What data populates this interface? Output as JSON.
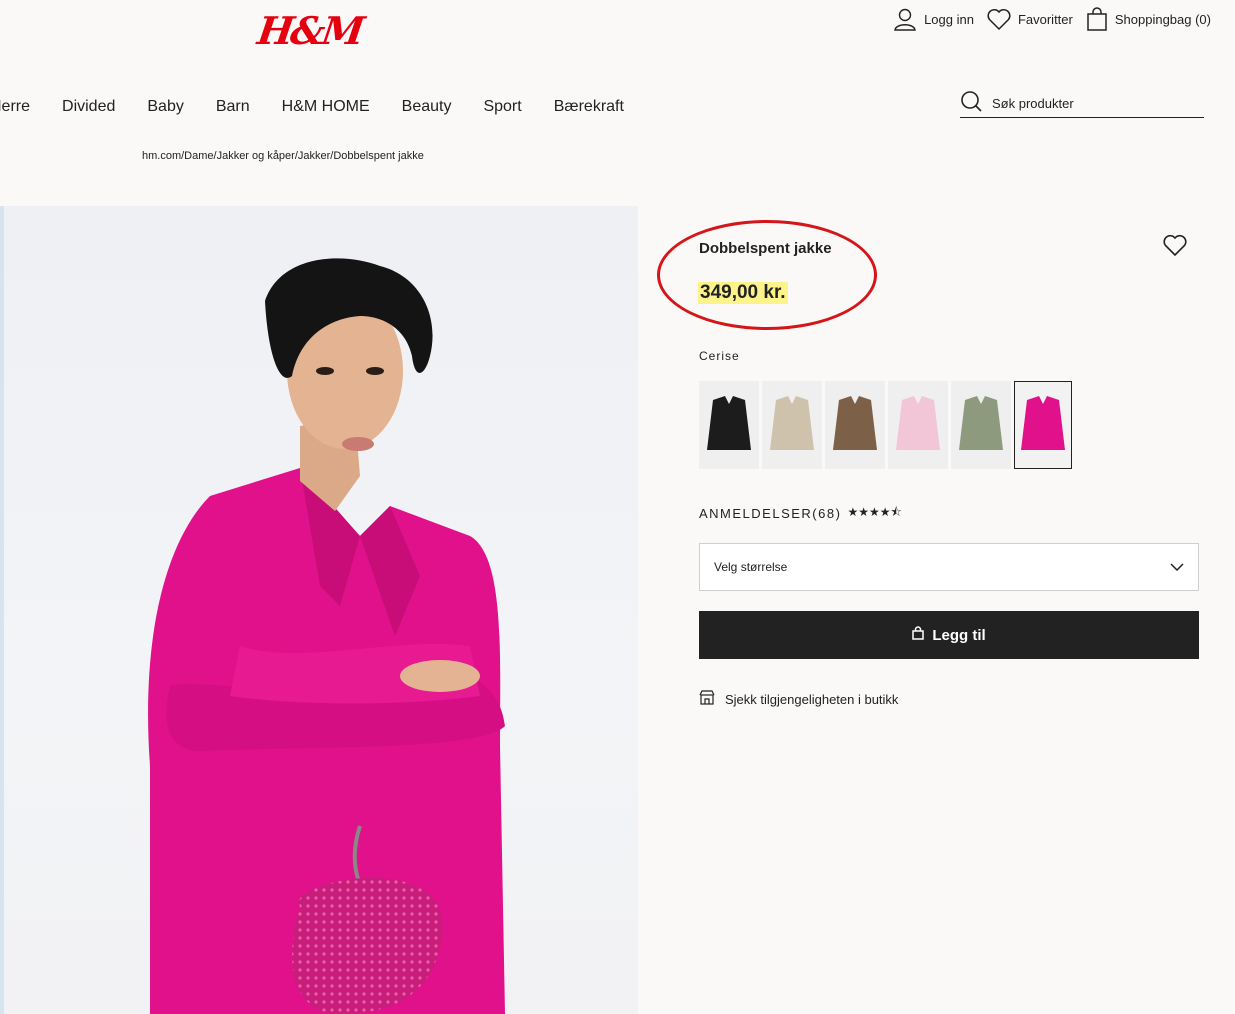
{
  "header": {
    "logo_text": "H&M",
    "util_nav": {
      "login": "Logg inn",
      "favorites": "Favoritter",
      "bag": "Shoppingbag (0)"
    }
  },
  "nav": {
    "items": [
      "Herre",
      "Divided",
      "Baby",
      "Barn",
      "H&M HOME",
      "Beauty",
      "Sport",
      "Bærekraft"
    ]
  },
  "search": {
    "placeholder": "Søk produkter"
  },
  "breadcrumb": "hm.com/Dame/Jakker og kåper/Jakker/Dobbelspent jakke",
  "product": {
    "title": "Dobbelspent jakke",
    "price": "349,00 kr.",
    "color_name": "Cerise",
    "swatches": [
      {
        "color": "#1c1c1c"
      },
      {
        "color": "#cfc2ad"
      },
      {
        "color": "#7d6048"
      },
      {
        "color": "#f2c6d6"
      },
      {
        "color": "#8d9a7d"
      },
      {
        "color": "#e0118a"
      }
    ],
    "reviews_label": "ANMELDELSER(68)",
    "stars": "★★★★⯪",
    "rating": 4.5,
    "size_placeholder": "Velg størrelse",
    "add_button": "Legg til",
    "store_link": "Sjekk tilgjengeligheten i butikk"
  },
  "colors": {
    "brand": "#e50010",
    "price_highlight": "#fcf38a",
    "annotation": "#d4161b",
    "jacket": "#e0118a"
  }
}
